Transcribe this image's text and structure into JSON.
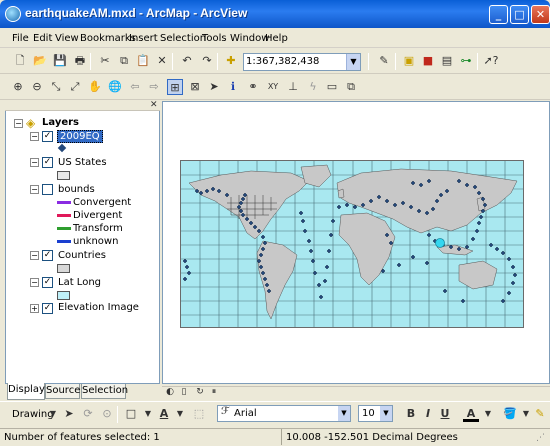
{
  "window": {
    "title": "earthquakeAM.mxd - ArcMap - ArcView"
  },
  "menu": [
    "File",
    "Edit",
    "View",
    "Bookmarks",
    "Insert",
    "Selection",
    "Tools",
    "Window",
    "Help"
  ],
  "standard_toolbar": {
    "scale": "1:367,382,438"
  },
  "toc": {
    "root_label": "Layers",
    "layers": [
      {
        "name": "2009EQ",
        "checked": true,
        "selected": true
      },
      {
        "name": "US States",
        "checked": true
      },
      {
        "name": "bounds",
        "checked": false,
        "legend": [
          "Convergent",
          "Divergent",
          "Transform",
          "unknown"
        ]
      },
      {
        "name": "Countries",
        "checked": true
      },
      {
        "name": "Lat Long",
        "checked": true
      },
      {
        "name": "Elevation Image",
        "checked": true
      }
    ],
    "tabs": [
      "Display",
      "Source",
      "Selection"
    ]
  },
  "colors": {
    "convergent": "#8a2be2",
    "divergent": "#e0185a",
    "transform": "#2e9e2e",
    "unknown": "#1a3fd0",
    "ocean": "#a9e8f0",
    "land": "#c8c8c8",
    "quake": "#24487a",
    "selection": "#316ac5"
  },
  "drawing_toolbar": {
    "drawing_label": "Drawing",
    "font": "Arial",
    "size": "10",
    "bold": "B",
    "italic": "I",
    "underline": "U",
    "text_tool": "A"
  },
  "status": {
    "selected": "Number of features selected: 1",
    "coords": "10.008  -152.501 Decimal Degrees"
  }
}
